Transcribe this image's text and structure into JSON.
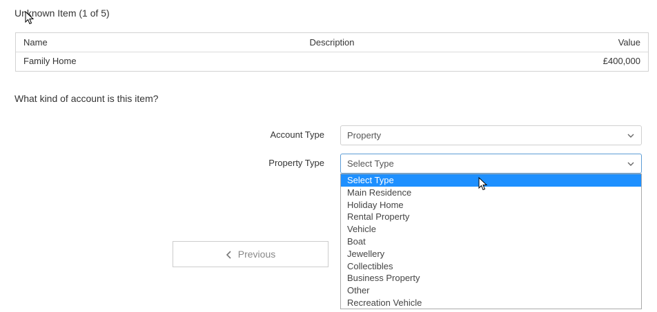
{
  "page": {
    "title": "Unknown Item (1 of 5)"
  },
  "table": {
    "headers": {
      "name": "Name",
      "description": "Description",
      "value": "Value"
    },
    "rows": [
      {
        "name": "Family Home",
        "description": "",
        "value": "£400,000"
      }
    ]
  },
  "question": "What kind of account is this item?",
  "form": {
    "account_type": {
      "label": "Account Type",
      "value": "Property"
    },
    "property_type": {
      "label": "Property Type",
      "value": "Select Type",
      "options": [
        "Select Type",
        "Main Residence",
        "Holiday Home",
        "Rental Property",
        "Vehicle",
        "Boat",
        "Jewellery",
        "Collectibles",
        "Business Property",
        "Other",
        "Recreation Vehicle"
      ],
      "highlighted_index": 0
    }
  },
  "nav": {
    "previous_label": "Previous"
  },
  "colors": {
    "highlight": "#1e90ff",
    "focus_border": "#5b9bd5"
  }
}
